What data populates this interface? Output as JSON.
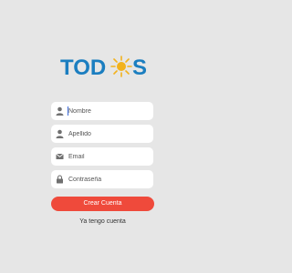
{
  "app": {
    "logo_text": "TODOS"
  },
  "form": {
    "fields": [
      {
        "name": "nombre",
        "placeholder": "Nombre",
        "value": "",
        "icon": "person-icon",
        "focused": true
      },
      {
        "name": "apellido",
        "placeholder": "Apellido",
        "value": "",
        "icon": "person-icon",
        "focused": false
      },
      {
        "name": "email",
        "placeholder": "Email",
        "value": "",
        "icon": "envelope-icon",
        "focused": false
      },
      {
        "name": "contrasena",
        "placeholder": "Contraseña",
        "value": "",
        "icon": "lock-icon",
        "focused": false
      }
    ],
    "submit_label": "Crear Cuenta",
    "login_link": "Ya tengo cuenta"
  },
  "colors": {
    "background": "#e6e6e6",
    "logo_blue": "#1b7ec0",
    "logo_sun": "#f2b21c",
    "primary_button": "#ef4a3b",
    "input_bg": "#ffffff"
  }
}
